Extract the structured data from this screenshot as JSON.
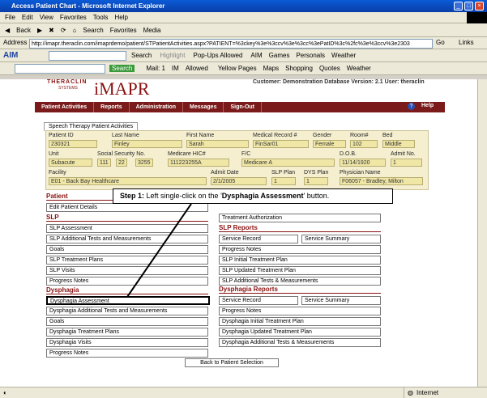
{
  "window": {
    "title": "Access Patient Chart - Microsoft Internet Explorer"
  },
  "menu": [
    "File",
    "Edit",
    "View",
    "Favorites",
    "Tools",
    "Help"
  ],
  "toolbar": {
    "back": "Back",
    "search": "Search",
    "favorites": "Favorites",
    "media": "Media"
  },
  "address": {
    "label": "Address",
    "url": "http://imapr.theraclin.com/imaprdemo/patient/STPatientActivities.aspx?PATIENT=%3ckey%3e%3ccv%3e%3cc%3ePatID%3c%2fc%3e%3ccv%3e2303",
    "go": "Go",
    "links": "Links"
  },
  "aim_bar": {
    "aim": "AIM",
    "search": "Search",
    "highlight": "Highlight",
    "popups": "Pop-Ups Allowed",
    "aim_menu": "AIM",
    "games": "Games",
    "personals": "Personals",
    "weather": "Weather"
  },
  "links_bar": {
    "search": "Search",
    "mail": "Mail: 1",
    "im": "IM",
    "allowed": "Allowed",
    "yellow": "Yellow Pages",
    "maps": "Maps",
    "shopping": "Shopping",
    "quotes": "Quotes",
    "weather": "Weather"
  },
  "brand": {
    "theraclin": "THERACLIN",
    "systems": "SYSTEMS",
    "imapr": "iMAPR"
  },
  "customer": "Customer: Demonstration Database Version: 2.1 User: theraclin",
  "nav": [
    "Patient Activities",
    "Reports",
    "Administration",
    "Messages",
    "Sign-Out"
  ],
  "help": "Help",
  "tab": "Speech Therapy Patient Activities",
  "patient": {
    "labels": {
      "patient_id": "Patient ID",
      "last_name": "Last Name",
      "first_name": "First Name",
      "mrn": "Medical Record #",
      "gender": "Gender",
      "room": "Room#",
      "bed": "Bed",
      "unit": "Unit",
      "ssn": "Social Security No.",
      "medicare": "Medicare HIC#",
      "fc": "F/C",
      "dob": "D.O.B.",
      "admit_no": "Admit No.",
      "facility": "Facility",
      "admit_date": "Admit Date",
      "slp_plan": "SLP Plan",
      "dys_plan": "DYS Plan",
      "physician": "Physician Name"
    },
    "values": {
      "patient_id": "230321",
      "last_name": "Finley",
      "first_name": "Sarah",
      "mrn": "FinSar01",
      "gender": "Female",
      "room": "102",
      "bed": "Middle",
      "unit": "Subacute",
      "ssn1": "111",
      "ssn2": "22",
      "ssn3": "3255",
      "medicare": "111223255A",
      "fc": "Medicare A",
      "dob": "11/14/1920",
      "admit_no": "1",
      "facility": "E01 - Back Bay Healthcare",
      "admit_date": "2/1/2005",
      "slp_plan": "1",
      "dys_plan": "1",
      "physician": "F06057 - Bradley, Milton"
    }
  },
  "sections": {
    "patient": "Patient",
    "slp": "SLP",
    "slp_reports": "SLP Reports",
    "dysphagia": "Dysphagia",
    "dysphagia_reports": "Dysphagia Reports"
  },
  "buttons": {
    "edit_patient": "Edit Patient Details",
    "treatment_auth": "Treatment Authorization",
    "slp_assessment": "SLP Assessment",
    "slp_additional": "SLP Additional Tests and Measurements",
    "goals": "Goals",
    "slp_treatment_plans": "SLP Treatment Plans",
    "slp_visits": "SLP Visits",
    "progress_notes": "Progress Notes",
    "service_record": "Service Record",
    "service_summary": "Service Summary",
    "r_progress_notes": "Progress Notes",
    "slp_initial": "SLP Initial Treatment Plan",
    "slp_updated": "SLP Updated Treatment Plan",
    "slp_add_tests": "SLP Additional Tests & Measurements",
    "dys_assessment": "Dysphagia Assessment",
    "dys_additional": "Dysphagia Additional Tests and Measurements",
    "dys_goals": "Goals",
    "dys_treatment_plans": "Dysphagia Treatment Plans",
    "dys_visits": "Dysphagia Visits",
    "dys_progress": "Progress Notes",
    "d_service_record": "Service Record",
    "d_service_summary": "Service Summary",
    "d_progress": "Progress Notes",
    "dys_initial": "Dysphagia Initial Treatment Plan",
    "dys_updated": "Dysphagia Updated Treatment Plan",
    "dys_add_tests": "Dysphagia Additional Tests & Measurements",
    "back": "Back to Patient Selection"
  },
  "callout": {
    "step": "Step 1:",
    "text1": " Left single-click on the '",
    "bold": "Dysphagia Assessment",
    "text2": "' button."
  },
  "status": {
    "zone": "Internet"
  }
}
